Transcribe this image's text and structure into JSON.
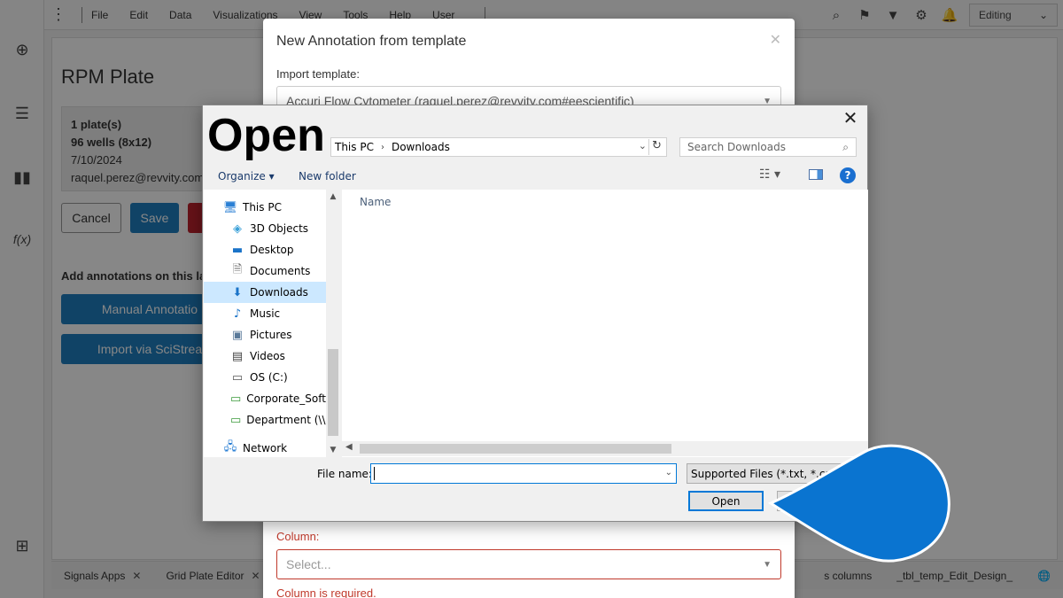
{
  "app": {
    "menu": [
      "File",
      "Edit",
      "Data",
      "Visualizations",
      "View",
      "Tools",
      "Help",
      "User"
    ],
    "mode": "Editing",
    "plate_title": "RPM Plate",
    "plate_info": {
      "plates": "1 plate(s)",
      "wells": "96 wells (8x12)",
      "date": "7/10/2024",
      "user": "raquel.perez@revvity.com"
    },
    "cancel_label": "Cancel",
    "save_label": "Save",
    "add_annotations_label": "Add annotations on this la",
    "manual_annotation_label": "Manual Annotatio",
    "import_scistream_label": "Import via SciStrea",
    "bottom_tabs": [
      "Signals Apps",
      "Grid Plate Editor",
      "s columns",
      "_tbl_temp_Edit_Design_"
    ]
  },
  "annotation_modal": {
    "title": "New Annotation from template",
    "import_template_label": "Import template:",
    "import_template_value": "Accuri Flow Cytometer (raquel.perez@revvity.com#eescientific)",
    "column_label": "Column:",
    "column_placeholder": "Select...",
    "column_error": "Column is required."
  },
  "open_dialog": {
    "title": "Open",
    "address": [
      "This PC",
      "Downloads"
    ],
    "search_placeholder": "Search Downloads",
    "organize_label": "Organize ▾",
    "new_folder_label": "New folder",
    "nav_items": [
      {
        "label": "This PC",
        "icon": "pc-icon"
      },
      {
        "label": "3D Objects",
        "icon": "3d-objects-icon"
      },
      {
        "label": "Desktop",
        "icon": "desktop-icon"
      },
      {
        "label": "Documents",
        "icon": "documents-icon"
      },
      {
        "label": "Downloads",
        "icon": "downloads-icon"
      },
      {
        "label": "Music",
        "icon": "music-icon"
      },
      {
        "label": "Pictures",
        "icon": "pictures-icon"
      },
      {
        "label": "Videos",
        "icon": "videos-icon"
      },
      {
        "label": "OS (C:)",
        "icon": "drive-icon"
      },
      {
        "label": "Corporate_Softw",
        "icon": "network-drive-icon"
      },
      {
        "label": "Department (\\\\c",
        "icon": "network-drive-icon"
      },
      {
        "label": "Network",
        "icon": "network-icon"
      }
    ],
    "selected_nav": "Downloads",
    "column_header": "Name",
    "file_name_label": "File name:",
    "file_name_value": "",
    "file_type_value": "Supported Files (*.txt, *.csv",
    "open_button": "Open"
  },
  "colors": {
    "accent": "#1f7fc0",
    "pointer": "#0a74d0",
    "error": "#c0392b"
  }
}
